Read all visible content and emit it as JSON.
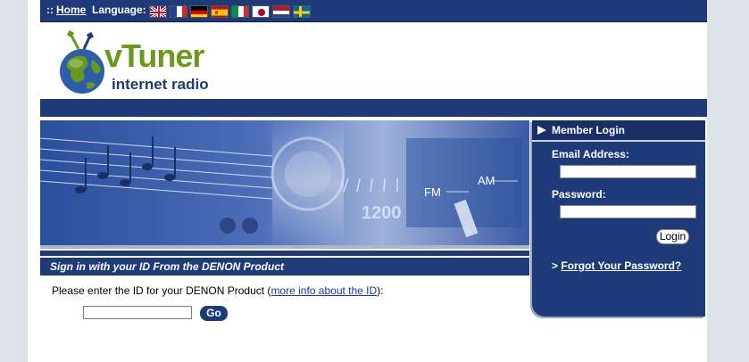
{
  "topbar": {
    "prefix": "::",
    "home_link": "Home",
    "language_label": "Language:",
    "flags": [
      {
        "icon": "uk-flag-icon"
      },
      {
        "icon": "france-flag-icon"
      },
      {
        "icon": "germany-flag-icon"
      },
      {
        "icon": "spain-flag-icon"
      },
      {
        "icon": "italy-flag-icon"
      },
      {
        "icon": "japan-flag-icon"
      },
      {
        "icon": "netherlands-flag-icon"
      },
      {
        "icon": "sweden-flag-icon"
      }
    ]
  },
  "logo": {
    "brand": "vTuner",
    "tagline": "internet radio"
  },
  "signin": {
    "header": "Sign in with your ID From the DENON Product",
    "instruction_prefix": "Please enter the ID for your DENON Product (",
    "info_link": "more info about the ID",
    "instruction_suffix": "):",
    "go_label": "Go"
  },
  "login": {
    "title": "Member Login",
    "email_label": "Email Address:",
    "password_label": "Password:",
    "login_button": "Login",
    "forgot_prefix": ">",
    "forgot_link": "Forgot Your Password?"
  },
  "banner": {
    "dial_fm": "FM",
    "dial_am": "AM",
    "dial_1200": "1200"
  },
  "colors": {
    "navy": "#1e3a78",
    "logo_green": "#6a9a1c",
    "logo_blue": "#1e3a78",
    "background": "#dde2e6"
  }
}
